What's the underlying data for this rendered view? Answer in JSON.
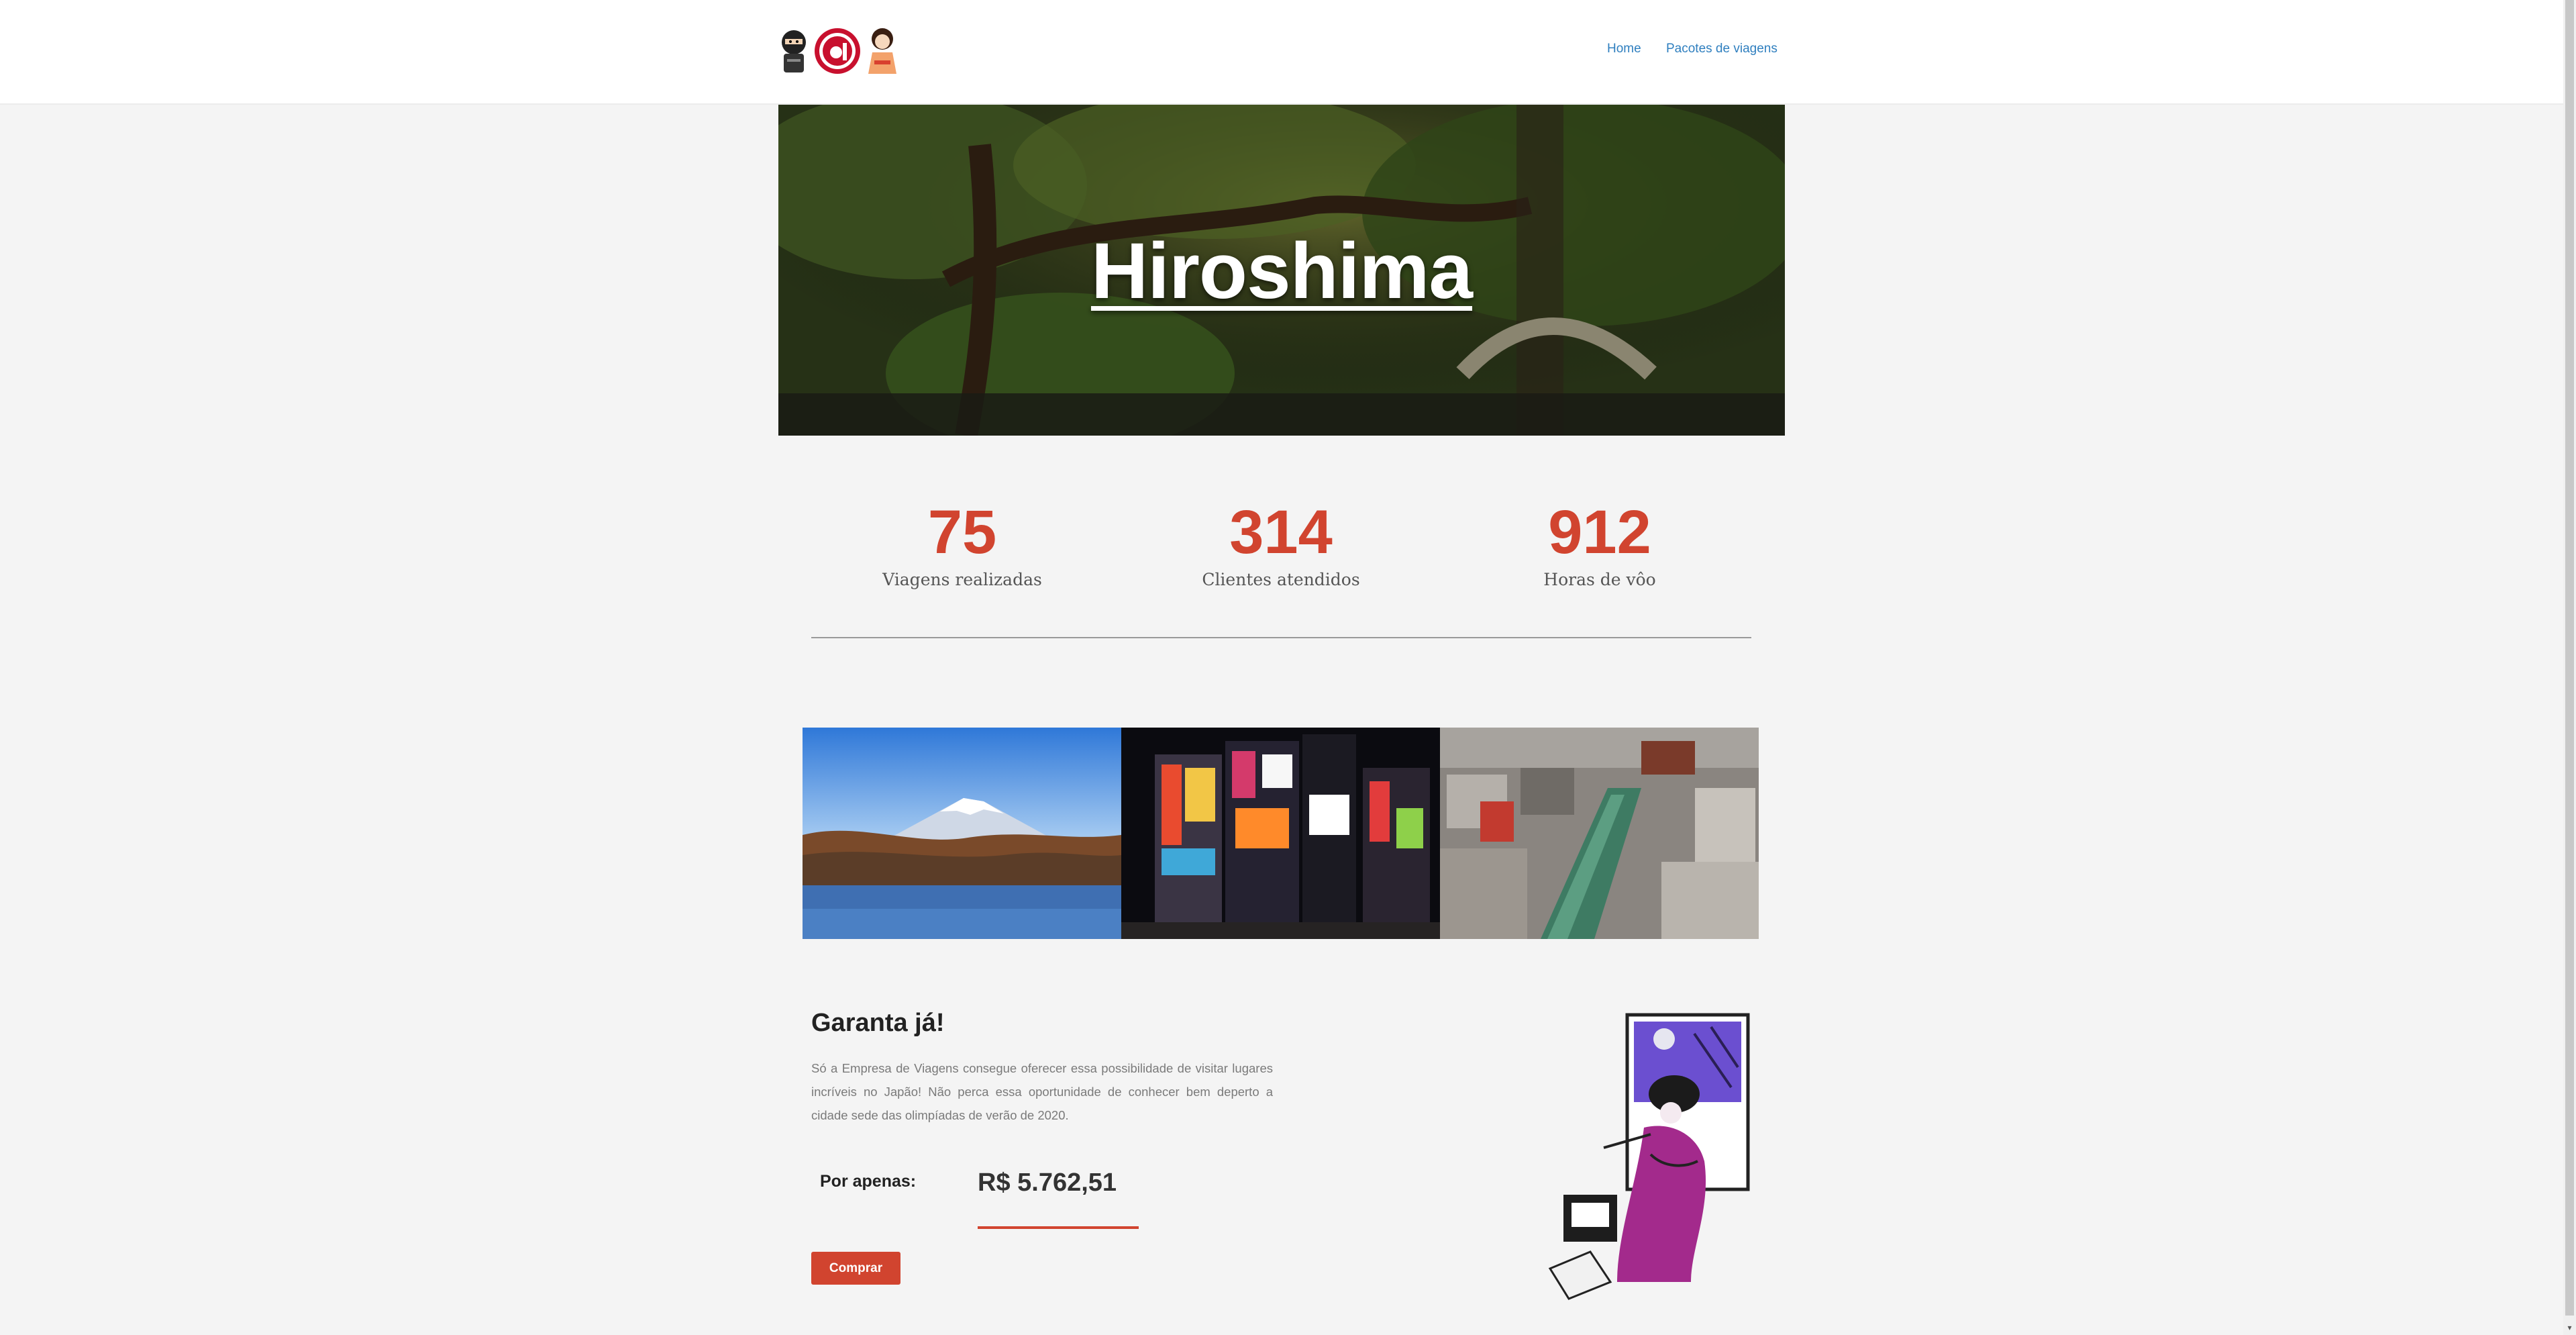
{
  "header": {
    "logo_name": "site-logo",
    "nav": [
      {
        "label": "Home"
      },
      {
        "label": "Pacotes de viagens"
      }
    ]
  },
  "hero": {
    "title": "Hiroshima"
  },
  "stats": [
    {
      "value": "75",
      "label": "Viagens realizadas"
    },
    {
      "value": "314",
      "label": "Clientes atendidos"
    },
    {
      "value": "912",
      "label": "Horas de vôo"
    }
  ],
  "gallery": [
    {
      "name": "mount-fuji-photo"
    },
    {
      "name": "night-city-photo"
    },
    {
      "name": "street-market-photo"
    }
  ],
  "cta": {
    "title": "Garanta já!",
    "text": "Só a Empresa de Viagens consegue oferecer essa possibilidade de visitar lugares incríveis no Japão! Não perca essa oportunidade de conhecer bem deperto a cidade sede das olimpíadas de verão de 2020.",
    "price_label": "Por apenas:",
    "price_value": "R$ 5.762,51",
    "buy_label": "Comprar"
  },
  "colors": {
    "accent": "#d1442f",
    "link": "#2f7fbf",
    "background": "#f4f4f4"
  }
}
